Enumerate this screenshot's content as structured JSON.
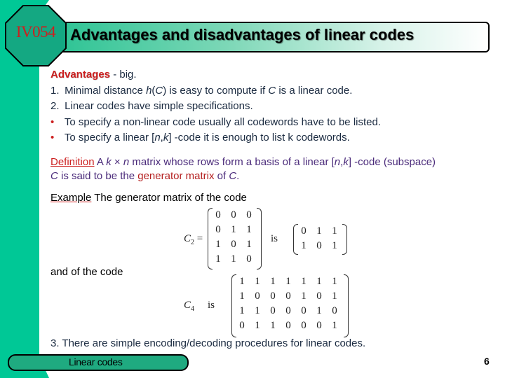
{
  "header": {
    "course_code": "IV054",
    "title": "Advantages and disadvantages of linear codes"
  },
  "advantages": {
    "heading": "Advantages",
    "heading_suffix": " - big.",
    "items": [
      {
        "marker": "1.",
        "parts": [
          "Minimal distance ",
          "h",
          "(",
          "C",
          ") is easy to compute if ",
          "C",
          " is a linear code."
        ]
      },
      {
        "marker": "2.",
        "text": "Linear codes have simple specifications."
      },
      {
        "marker": "•",
        "text": "To specify a non-linear code usually all codewords have to be listed."
      },
      {
        "marker": "•",
        "parts": [
          "To specify a linear [",
          "n",
          ",",
          "k",
          "] -code it is enough to list k codewords."
        ]
      }
    ]
  },
  "definition": {
    "label": "Definition",
    "line1_a": " A ",
    "k": "k",
    "times": " × ",
    "n": "n",
    "line1_b": " matrix whose rows form a basis of a linear [",
    "n2": "n",
    "comma": ",",
    "k2": "k",
    "line1_c": "] -code (subspace)",
    "C1": "C",
    "line2_a": " is said to be the ",
    "generator": "generator matrix",
    "line2_b": " of ",
    "C2": "C",
    "period": "."
  },
  "example": {
    "label": "Example",
    "text": " The generator matrix of the code",
    "c2_label": "C",
    "c2_sub": "2",
    "equals": " =",
    "is_word": "is",
    "c2_matrix": [
      [
        "0",
        "0",
        "0"
      ],
      [
        "0",
        "1",
        "1"
      ],
      [
        "1",
        "0",
        "1"
      ],
      [
        "1",
        "1",
        "0"
      ]
    ],
    "c2_generator": [
      [
        "0",
        "1",
        "1"
      ],
      [
        "1",
        "0",
        "1"
      ]
    ],
    "and_text": "and of the code",
    "c4_label": "C",
    "c4_sub": "4",
    "c4_is": "is",
    "c4_generator": [
      [
        "1",
        "1",
        "1",
        "1",
        "1",
        "1",
        "1"
      ],
      [
        "1",
        "0",
        "0",
        "0",
        "1",
        "0",
        "1"
      ],
      [
        "1",
        "1",
        "0",
        "0",
        "0",
        "1",
        "0"
      ],
      [
        "0",
        "1",
        "1",
        "0",
        "0",
        "0",
        "1"
      ]
    ]
  },
  "point3": "3. There are simple encoding/decoding procedures for linear codes.",
  "footer": {
    "label": "Linear codes",
    "page_number": "6"
  },
  "colors": {
    "accent_green": "#00c896",
    "octagon_green": "#14a882",
    "heading_red": "#cc1f1f",
    "definition_purple": "#4a2a7a"
  }
}
